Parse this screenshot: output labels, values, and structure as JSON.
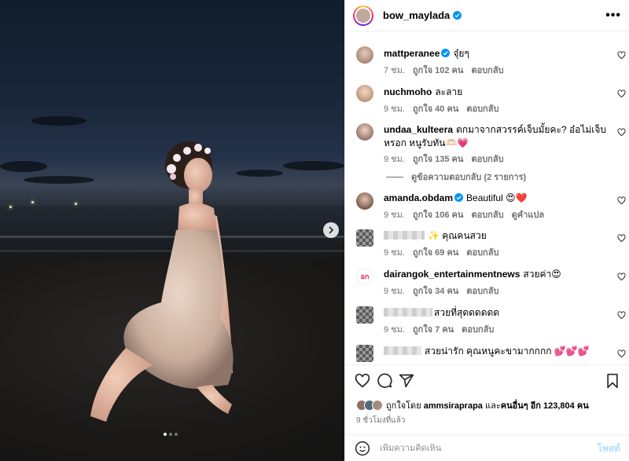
{
  "post": {
    "username": "bow_maylada",
    "more_label": "•••",
    "slide_count": 3,
    "active_slide": 1
  },
  "comments": [
    {
      "username": "mattperanee",
      "verified": true,
      "text": "จุ๋ยๆ",
      "time": "7 ชม.",
      "likes": "ถูกใจ 102 คน",
      "reply": "ตอบกลับ",
      "extra": ""
    },
    {
      "username": "nuchmoho",
      "verified": false,
      "text": "ละลาย",
      "time": "9 ชม.",
      "likes": "ถูกใจ 40 คน",
      "reply": "ตอบกลับ",
      "extra": ""
    },
    {
      "username": "undaa_kulteera",
      "verified": false,
      "text": "ตกมาจากสวรรค์เจ็บมั้ยคะ? อ๋อไม่เจ็บหรอก หนูรับทัน🫶🏻💗",
      "time": "9 ชม.",
      "likes": "ถูกใจ 135 คน",
      "reply": "ตอบกลับ",
      "extra": ""
    },
    {
      "username": "amanda.obdam",
      "verified": true,
      "text": "Beautiful 😍❤️",
      "time": "9 ชม.",
      "likes": "ถูกใจ 106 คน",
      "reply": "ตอบกลับ",
      "extra": "ดูคำแปล"
    },
    {
      "username": "",
      "verified": false,
      "text": "✨ คุณคนสวย",
      "time": "9 ชม.",
      "likes": "ถูกใจ 69 คน",
      "reply": "ตอบกลับ",
      "extra": ""
    },
    {
      "username": "dairangok_entertainmentnews",
      "verified": false,
      "text": "สวยค่า😍",
      "time": "9 ชม.",
      "likes": "ถูกใจ 34 คน",
      "reply": "ตอบกลับ",
      "extra": ""
    },
    {
      "username": "",
      "verified": false,
      "text": "สวยที่สุดดดดดด",
      "time": "9 ชม.",
      "likes": "ถูกใจ 7 คน",
      "reply": "ตอบกลับ",
      "extra": ""
    },
    {
      "username": "",
      "verified": false,
      "text": "สวยน่ารัก คุณหนูคะขามากกกก 💕💕💕",
      "time": "",
      "likes": "",
      "reply": "",
      "extra": ""
    }
  ],
  "view_replies": "ดูข้อความตอบกลับ (2 รายการ)",
  "liked_by": {
    "prefix": "ถูกใจโดย",
    "user": "ammsiraprapa",
    "middle": "และ",
    "others": "คนอื่นๆ อีก 123,804 คน"
  },
  "time_ago": "9 ชั่วโมงที่แล้ว",
  "add_comment": {
    "placeholder": "เพิ่มความคิดเห็น",
    "post_label": "โพสต์"
  },
  "colors": {
    "verified": "#0095f6",
    "post_button_disabled": "#b2dffc",
    "meta_text": "#737373"
  },
  "icons": [
    "more-icon",
    "heart-icon",
    "comment-icon",
    "share-icon",
    "bookmark-icon",
    "emoji-icon",
    "verified-icon",
    "chevron-right-icon"
  ]
}
